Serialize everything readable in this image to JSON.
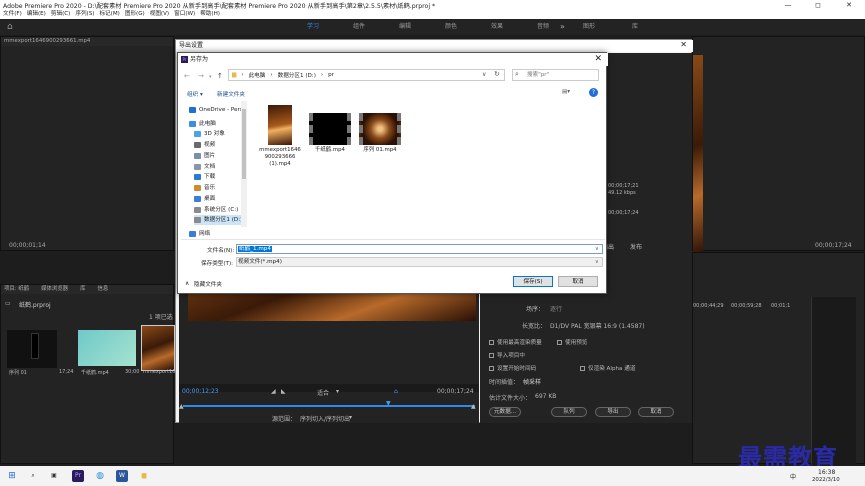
{
  "title": {
    "text": "Adobe Premiere Pro 2020 - D:\\配套素材 Premiere Pro 2020 从新手到高手\\配套素材 Premiere Pro 2020 从新手到高手\\第2章\\2.5.5\\素材\\纸鹤.prproj *",
    "min": "—",
    "max": "◻",
    "close": "✕"
  },
  "menu": [
    "文件(F)",
    "编辑(E)",
    "剪辑(C)",
    "序列(S)",
    "标记(M)",
    "图形(G)",
    "视图(V)",
    "窗口(W)",
    "帮助(H)"
  ],
  "workspace": {
    "tabs": [
      "学习",
      "组件",
      "编辑",
      "颜色",
      "效果",
      "音频",
      "图形",
      "库"
    ],
    "active": "学习",
    "more": "»"
  },
  "source_panel": {
    "title": "mmexport1646900293661.mp4",
    "timecode": "00;00;01;14"
  },
  "export_dialog": {
    "title": "导出设置",
    "close": "✕",
    "timecode_left": "00;00;12;23",
    "timecode_right": "00;00;17;24",
    "zoom": "适合",
    "source_range_label": "源范围：",
    "source_range_value": "序列切入/序列切出",
    "output_tab": "输出",
    "publish_tab": "发布",
    "info_lines": [
      "00;00;17;21",
      "49.12 kbps",
      "00;00;17;24"
    ],
    "hdr_format": "格式：",
    "hdr_format_val": "",
    "hdr_preset": "预设：",
    "hdr_preset_val": "",
    "fields": [
      {
        "label": "场序：",
        "value": "逐行"
      },
      {
        "label": "长宽比：",
        "value": "D1/DV PAL 宽银幕 16:9 (1.4587)"
      }
    ],
    "checkboxes": [
      "使用最高渲染质量",
      "使用预览",
      "导入项目中",
      "设置开始时间码",
      "仅渲染 Alpha 通道"
    ],
    "interp_label": "时间插值：",
    "interp_value": "帧采样",
    "filesize_label": "估计文件大小：",
    "filesize_value": "697 KB",
    "buttons": {
      "metadata": "元数据...",
      "queue": "队列",
      "export": "导出",
      "cancel": "取消"
    }
  },
  "save_as": {
    "app_badge": "Pr",
    "title": "另存为",
    "close": "✕",
    "path": [
      "此电脑",
      "数据分区1 (D:)",
      "pr"
    ],
    "search_placeholder": "搜索\"pr\"",
    "organize": "组织 ▾",
    "new_folder": "新建文件夹",
    "nav": [
      {
        "label": "OneDrive - Pers",
        "color": "#1e6fd9"
      },
      {
        "label": "此电脑",
        "color": "#3a8ee6"
      },
      {
        "label": "3D 对象",
        "color": "#4aa3e8"
      },
      {
        "label": "视频",
        "color": "#6a6a6a"
      },
      {
        "label": "图片",
        "color": "#7a8fa8"
      },
      {
        "label": "文档",
        "color": "#8a96a6"
      },
      {
        "label": "下载",
        "color": "#2b79d0"
      },
      {
        "label": "音乐",
        "color": "#d28a2e"
      },
      {
        "label": "桌面",
        "color": "#3a7fd5"
      },
      {
        "label": "系统分区 (C:)",
        "color": "#8a8a8a"
      },
      {
        "label": "数据分区1 (D:)",
        "color": "#8a8a8a"
      },
      {
        "label": "网络",
        "color": "#3a7fd5"
      }
    ],
    "files": [
      {
        "name_lines": [
          "mmexport1646",
          "900293666",
          "(1).mp4"
        ]
      },
      {
        "name_lines": [
          "千纸鹤.mp4"
        ]
      },
      {
        "name_lines": [
          "序列 01.mp4"
        ]
      }
    ],
    "filename_label": "文件名(N):",
    "filename_value": "纸鹤_1.mp4",
    "filetype_label": "保存类型(T):",
    "filetype_value": "视频文件(*.mp4)",
    "hide_folders": "隐藏文件夹",
    "save": "保存(S)",
    "cancel": "取消"
  },
  "project_panel": {
    "tabs": [
      "项目: 纸鹤",
      "媒体浏览器",
      "库",
      "信息"
    ],
    "project_name": "纸鹤.prproj",
    "count": "1 项已选",
    "items": [
      {
        "name": "序列 01",
        "dur": "17;24"
      },
      {
        "name": "千纸鹤.mp4",
        "dur": "30;00"
      },
      {
        "name": "mmexport1646...",
        "dur": ""
      }
    ]
  },
  "right_panel": {
    "timecode": "00;00;17;24",
    "ruler": [
      "00;00;44;29",
      "00;00;59;28",
      "00;01;1"
    ]
  },
  "taskbar": {
    "time": "16:38",
    "date": "2022/3/10",
    "lang": "中"
  },
  "watermark": "最需教育"
}
